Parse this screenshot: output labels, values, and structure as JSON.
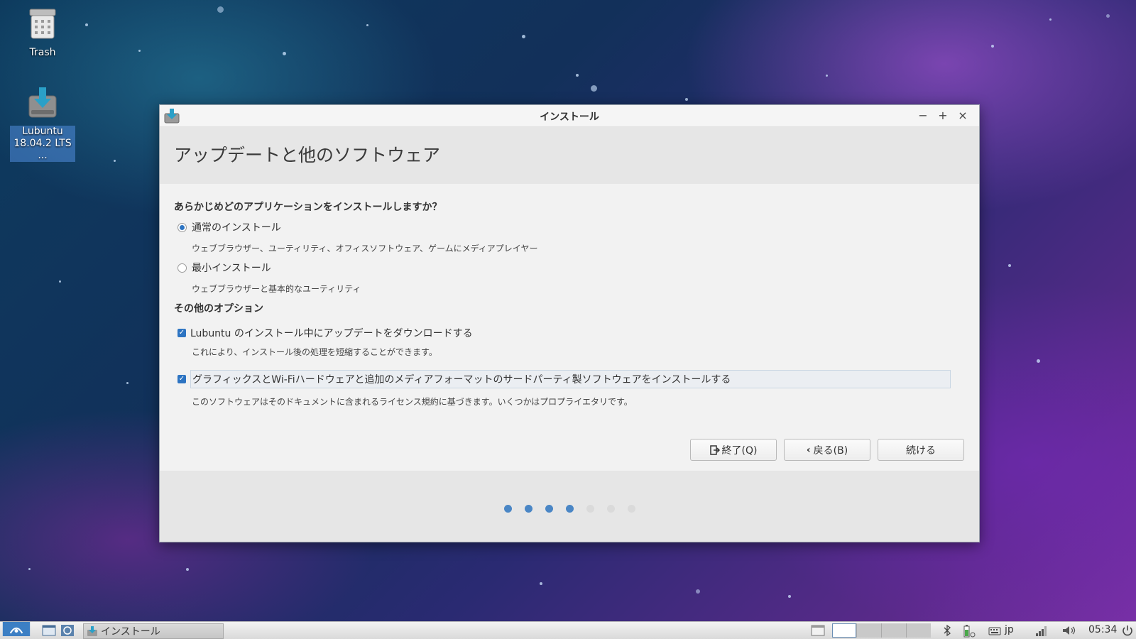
{
  "desktop": {
    "icons": [
      {
        "label": "Trash",
        "icon": "trash-icon"
      },
      {
        "label_line1": "Lubuntu",
        "label_line2": "18.04.2 LTS ...",
        "icon": "installer-icon"
      }
    ]
  },
  "window": {
    "title": "インストール",
    "controls": {
      "minimize": "−",
      "maximize": "+",
      "close": "×"
    },
    "header_title": "アップデートと他のソフトウェア",
    "install_question": "あらかじめどのアプリケーションをインストールしますか？",
    "normal_install": {
      "label": "通常のインストール",
      "description": "ウェブブラウザー、ユーティリティ、オフィスソフトウェア、ゲームにメディアプレイヤー",
      "selected": true
    },
    "minimal_install": {
      "label": "最小インストール",
      "description": "ウェブブラウザーと基本的なユーティリティ",
      "selected": false
    },
    "other_options_title": "その他のオプション",
    "download_updates": {
      "label": "Lubuntu のインストール中にアップデートをダウンロードする",
      "description": "これにより、インストール後の処理を短縮することができます。",
      "checked": true
    },
    "third_party": {
      "label": "グラフィックスとWi-Fiハードウェアと追加のメディアフォーマットのサードパーティ製ソフトウェアをインストールする",
      "description": "このソフトウェアはそのドキュメントに含まれるライセンス規約に基づきます。いくつかはプロプライエタリです。",
      "checked": true
    },
    "buttons": {
      "quit": "終了(Q)",
      "back": "戻る(B)",
      "continue": "続ける"
    },
    "progress": {
      "total_steps": 7,
      "completed_steps": 4,
      "active_color": "#4a86c5",
      "inactive_color": "#dadada"
    }
  },
  "taskbar": {
    "task_label": "インストール",
    "keyboard_layout": "jp",
    "clock": "05:34"
  },
  "colors": {
    "accent": "#2d74c2"
  }
}
